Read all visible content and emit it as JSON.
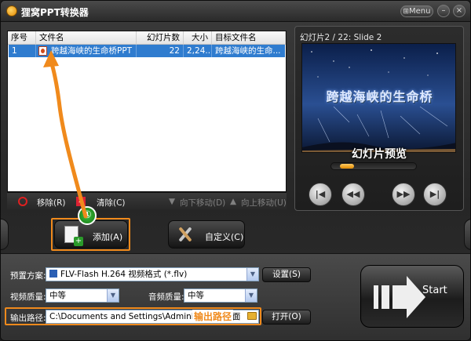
{
  "window": {
    "title": "狸窝PPT转换器",
    "menu_label": "Menu"
  },
  "file_list": {
    "columns": [
      "序号",
      "文件名",
      "幻灯片数",
      "大小",
      "目标文件名"
    ],
    "rows": [
      {
        "index": "1",
        "filename": "跨越海峡的生命桥PPT",
        "slides": "22",
        "size": "2,24...",
        "target": "跨越海峡的生命..."
      }
    ]
  },
  "list_actions": {
    "remove": "移除(R)",
    "clear": "清除(C)",
    "move_down": "向下移动(D)",
    "move_up": "向上移动(U)"
  },
  "preview": {
    "label": "幻灯片2 / 22: Slide 2",
    "slide_title": "跨越海峡的生命桥",
    "annotation": "幻灯片预览",
    "slider_fraction": 0.1
  },
  "buttons": {
    "add": "添加(A)",
    "add_badge": "①",
    "custom": "自定义(C)",
    "settings": "设置(S)",
    "open": "打开(O)",
    "start": "Start"
  },
  "settings": {
    "preset_label": "预置方案:",
    "preset_value": "FLV-Flash H.264 视频格式 (*.flv)",
    "video_quality_label": "视频质量:",
    "video_quality_value": "中等",
    "audio_quality_label": "音频质量:",
    "audio_quality_value": "中等",
    "output_label": "输出路径:",
    "output_value": "C:\\Documents and Settings\\Administrator\\桌面",
    "output_annotation": "输出路径"
  },
  "colors": {
    "annotation_orange": "#f08a1c",
    "selection_blue": "#2f7ccf"
  }
}
